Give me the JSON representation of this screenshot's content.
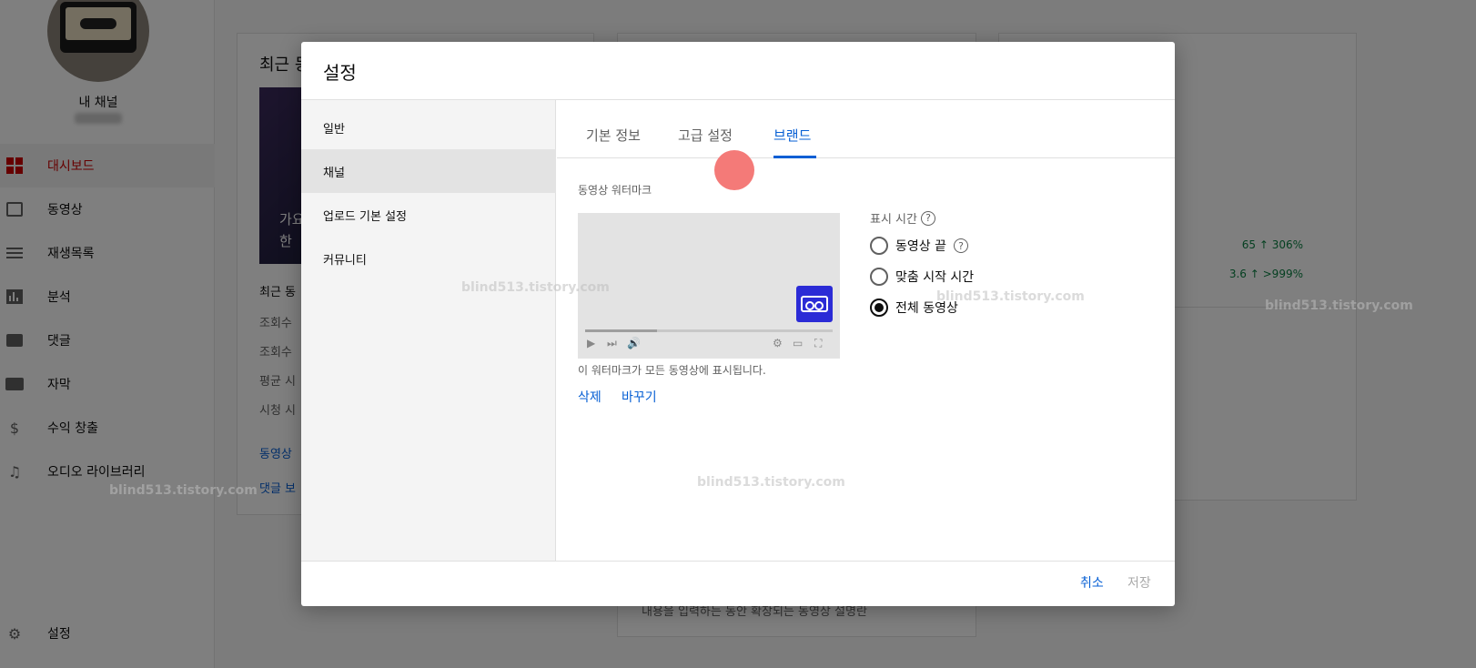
{
  "sidebar": {
    "channel_name": "내 채널",
    "items": [
      {
        "label": "대시보드",
        "icon": "dashboard-icon"
      },
      {
        "label": "동영상",
        "icon": "video-icon"
      },
      {
        "label": "재생목록",
        "icon": "playlist-icon"
      },
      {
        "label": "분석",
        "icon": "analytics-icon"
      },
      {
        "label": "댓글",
        "icon": "comments-icon"
      },
      {
        "label": "자막",
        "icon": "subtitles-icon"
      },
      {
        "label": "수익 창출",
        "icon": "dollar-icon"
      },
      {
        "label": "오디오 라이브러리",
        "icon": "audio-library-icon"
      }
    ],
    "settings_label": "설정"
  },
  "background": {
    "card_title": "최근 동",
    "recent_label": "최근 동",
    "rows": [
      "조회수",
      "조회수",
      "평균 시",
      "시청 시"
    ],
    "links": [
      "동영상",
      "댓글 보"
    ],
    "thumb_text": [
      "가요",
      "한"
    ],
    "stats": [
      {
        "value": "65",
        "change": "306%"
      },
      {
        "value": "3.6",
        "change": ">999%"
      }
    ],
    "bottom_text": "내용을 입력하는 동안 확장되는 동영상 설명란"
  },
  "dialog": {
    "title": "설정",
    "nav": [
      "일반",
      "채널",
      "업로드 기본 설정",
      "커뮤니티"
    ],
    "selected_nav": 1,
    "tabs": [
      "기본 정보",
      "고급 설정",
      "브랜드"
    ],
    "active_tab": 2,
    "section_label": "동영상 워터마크",
    "caption": "이 워터마크가 모든 동영상에 표시됩니다.",
    "actions": {
      "delete": "삭제",
      "change": "바꾸기"
    },
    "display_time": {
      "label": "표시 시간",
      "options": [
        "동영상 끝",
        "맞춤 시작 시간",
        "전체 동영상"
      ],
      "selected": 2
    },
    "footer": {
      "cancel": "취소",
      "save": "저장"
    }
  },
  "watermark_text": "blind513.tistory.com",
  "colors": {
    "accent": "#065fd4",
    "active_nav": "#cc0000",
    "watermark_tile": "#2b2bd6",
    "click_indicator": "#f47a78"
  }
}
